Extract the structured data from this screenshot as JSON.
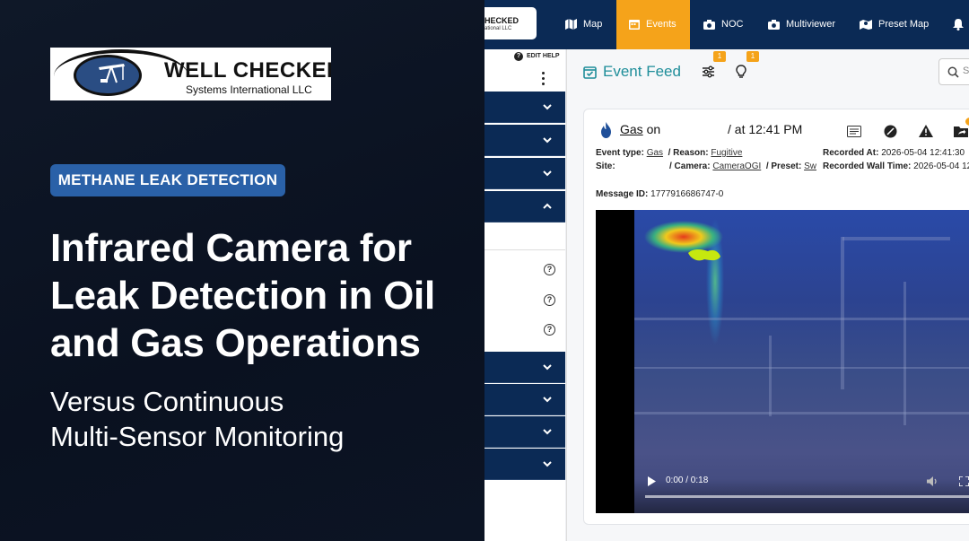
{
  "left": {
    "logo": {
      "brand": "WELL CHECKED",
      "subtitle": "Systems International LLC"
    },
    "pill_label": "METHANE LEAK DETECTION",
    "headline": "Infrared Camera for Leak Detection in Oil and Gas Operations",
    "subhead_line1": "Versus Continuous",
    "subhead_line2": "Multi-Sensor Monitoring",
    "colors": {
      "pill": "#2a61a8",
      "background": "#0b1220"
    }
  },
  "app": {
    "logo_text": "HECKED",
    "logo_sub": "ational LLC",
    "nav": [
      {
        "label": "Map",
        "icon": "map-icon"
      },
      {
        "label": "Events",
        "icon": "calendar-icon",
        "active": true
      },
      {
        "label": "NOC",
        "icon": "camera-icon"
      },
      {
        "label": "Multiviewer",
        "icon": "camera-icon"
      },
      {
        "label": "Preset Map",
        "icon": "map-pin-icon"
      }
    ],
    "sidebar": {
      "edit_help": "EDIT HELP"
    },
    "feed": {
      "title": "Event Feed",
      "filter_badge": "1",
      "idea_badge": "1",
      "search_placeholder": "S",
      "event": {
        "gas": "Gas",
        "on": "on",
        "at_time": "/ at 12:41 PM",
        "event_type_label": "Event type:",
        "event_type": "Gas",
        "reason_label": "/  Reason:",
        "reason": "Fugitive",
        "recorded_at_label": "Recorded At:",
        "recorded_at": "2026-05-04 12:41:30",
        "site_label": "Site:",
        "camera_label": "/  Camera:",
        "camera": "CameraOGI",
        "preset_label": "/  Preset:",
        "preset": "Sw",
        "wall_time_label": "Recorded Wall Time:",
        "wall_time": "2026-05-04 12",
        "message_id_label": "Message ID:",
        "message_id": "1777916686747-0"
      },
      "video": {
        "time": "0:00 / 0:18"
      }
    }
  }
}
